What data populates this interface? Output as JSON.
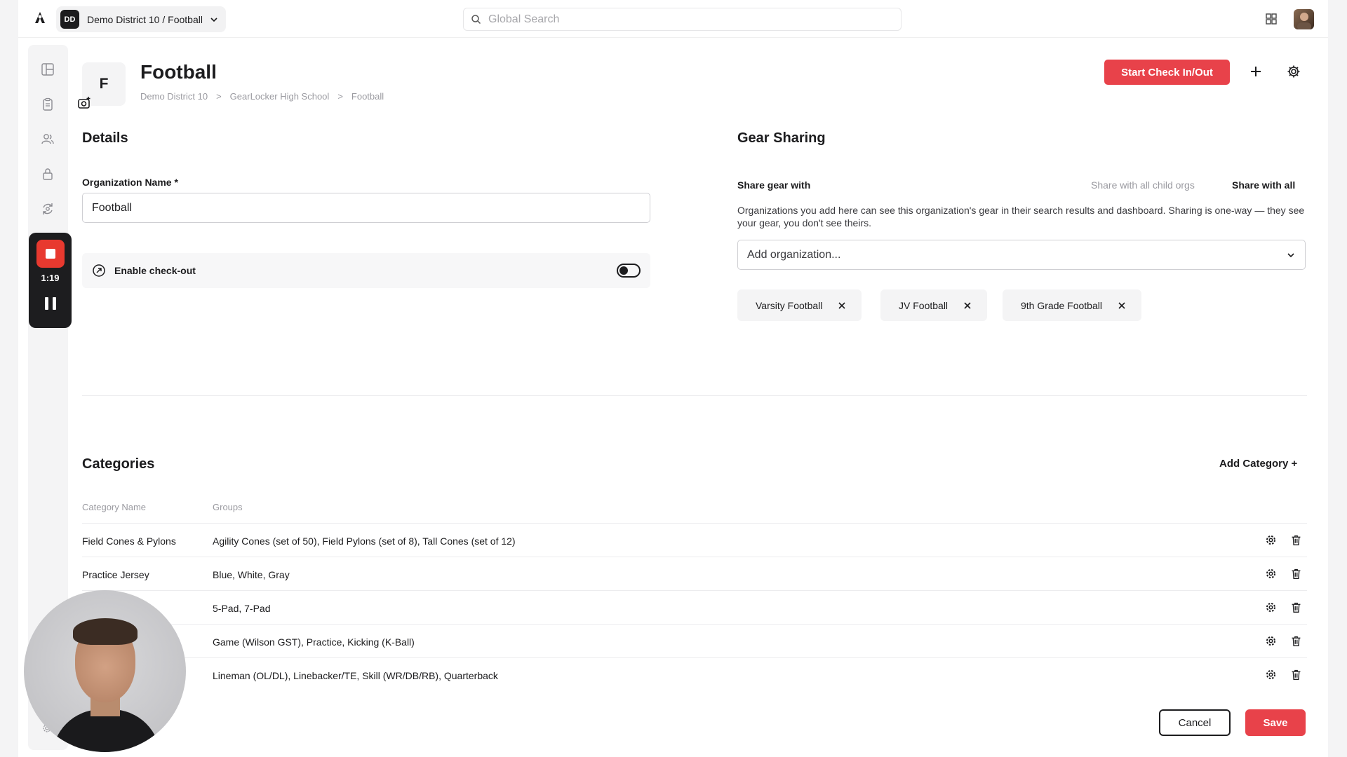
{
  "topbar": {
    "org_badge": "DD",
    "org_switcher_label": "Demo District 10 / Football",
    "search_placeholder": "Global Search"
  },
  "recorder": {
    "time": "1:19"
  },
  "header": {
    "avatar_letter": "F",
    "title": "Football",
    "breadcrumb": [
      "Demo District 10",
      ">",
      "GearLocker High School",
      ">",
      "Football"
    ],
    "start_button": "Start Check In/Out"
  },
  "details": {
    "heading": "Details",
    "org_name_label": "Organization Name *",
    "org_name_value": "Football",
    "checkout_label": "Enable check-out",
    "checkout_enabled": false
  },
  "gear_sharing": {
    "heading": "Gear Sharing",
    "share_label": "Share gear with",
    "option_child_orgs": "Share with all child orgs",
    "option_all": "Share with all",
    "description": "Organizations you add here can see this organization's gear in their search results and dashboard. Sharing is one-way — they see your gear, you don't see theirs.",
    "add_placeholder": "Add organization...",
    "chips": [
      "Varsity Football",
      "JV Football",
      "9th Grade Football"
    ]
  },
  "categories": {
    "heading": "Categories",
    "add_button": "Add Category +",
    "columns": [
      "Category Name",
      "Groups"
    ],
    "rows": [
      {
        "name": "Field Cones & Pylons",
        "groups": "Agility Cones (set of 50), Field Pylons (set of 8), Tall Cones (set of 12)"
      },
      {
        "name": "Practice Jersey",
        "groups": "Blue, White, Gray"
      },
      {
        "name": "",
        "groups": "5-Pad, 7-Pad"
      },
      {
        "name": "",
        "groups": "Game (Wilson GST), Practice, Kicking (K-Ball)"
      },
      {
        "name": "",
        "groups": "Lineman (OL/DL), Linebacker/TE, Skill (WR/DB/RB), Quarterback"
      }
    ]
  },
  "footer": {
    "cancel": "Cancel",
    "save": "Save"
  },
  "colors": {
    "accent": "#e8424a",
    "record": "#e8392f",
    "text": "#1c1c1e",
    "muted": "#9a9aa0"
  }
}
